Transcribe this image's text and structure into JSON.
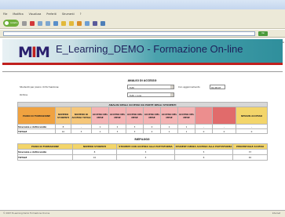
{
  "browser": {
    "menu": [
      "File",
      "Modifica",
      "Visualizza",
      "Preferiti",
      "Strumenti",
      "?"
    ],
    "back_label": "Indietro",
    "go_label": "Vai",
    "links_label": "Collegamenti",
    "toolbar_colors": [
      "#9a9a9a",
      "#d2383a",
      "#7ea7cf",
      "#7ea7cf",
      "#5a8fc9",
      "#e2b93b",
      "#e2b93b",
      "#d98d2a",
      "#6d9ed3",
      "#5b5b9a",
      "#4e7fb8"
    ]
  },
  "header": {
    "site_title": "E_Learning_DEMO - Formazione On-line"
  },
  "colors": {
    "accent_red": "#c0201e",
    "teal": "#2f8f9c",
    "header_orange": "#f0a240",
    "header_yellow": "#f3d56a",
    "red_column": "#e16b6b"
  },
  "filters": {
    "section_title": "ANALISI DI ACCESSO",
    "row1_label": "Studenti per piano di formazione:",
    "row1_select": "Tutti",
    "row1_label2": "Con aggiornamento",
    "row1_box": "01.08.07",
    "row2_label": "Ordina",
    "row2_select": "Tutti i corsi"
  },
  "main_table": {
    "caption": "ANALISI DEGLI ACCESSI DA PARTE DEGLI STUDENTI",
    "headers": [
      {
        "label": "PIANO DI FORMAZIONE",
        "color": "#f0a240"
      },
      {
        "label": "NUMERO STUDENTI",
        "color": "#f6c77a"
      },
      {
        "label": "NUMERO DI ACCESSI TOTALI",
        "color": "#f6c77a"
      },
      {
        "label": "ACCESSI NEL MESE",
        "color": "#f4b3b3"
      },
      {
        "label": "ACCESSI NEL MESE",
        "color": "#f4b3b3"
      },
      {
        "label": "ACCESSI NEL MESE",
        "color": "#f4b3b3"
      },
      {
        "label": "ACCESSI NEL MESE",
        "color": "#f4b3b3"
      },
      {
        "label": "ACCESSI NEL MESE",
        "color": "#f4b3b3"
      },
      {
        "label": "ACCESSI NEL MESE",
        "color": "#f4b3b3"
      },
      {
        "label": "",
        "color": "#ec8e8e"
      },
      {
        "label": "",
        "color": "#e16b6b"
      },
      {
        "label": "NESSUN ACCESSO",
        "color": "#f3d56a"
      }
    ],
    "rows": [
      [
        "Sicurezza e Antincendio",
        "8",
        "-",
        "1",
        "2",
        "3",
        "0",
        "1",
        "1",
        "-",
        "-",
        "-"
      ],
      [
        "TOTALE",
        "10",
        "3",
        "1",
        "3",
        "3",
        "2",
        "1",
        "1",
        "0",
        "0",
        "0"
      ]
    ]
  },
  "summary_table": {
    "section_title": "RIEPILOGO",
    "headers": [
      "PIANO DI FORMAZIONE",
      "NUMERO STUDENTI",
      "STUDENTI CON ACCESSO ALLA PIATTAFORMA",
      "STUDENTI SENZA ACCESSO ALLA PIATTAFORMA",
      "PERCENTUALE ACCESSI"
    ],
    "rows": [
      [
        "Sicurezza e Antincendio",
        "8",
        "3",
        "5",
        "37"
      ],
      [
        "TOTALE",
        "10",
        "4",
        "6",
        "40"
      ]
    ]
  },
  "footer": {
    "status": "© 2007 E-Learning Demo Formazione On-line",
    "zone": "Internet"
  }
}
